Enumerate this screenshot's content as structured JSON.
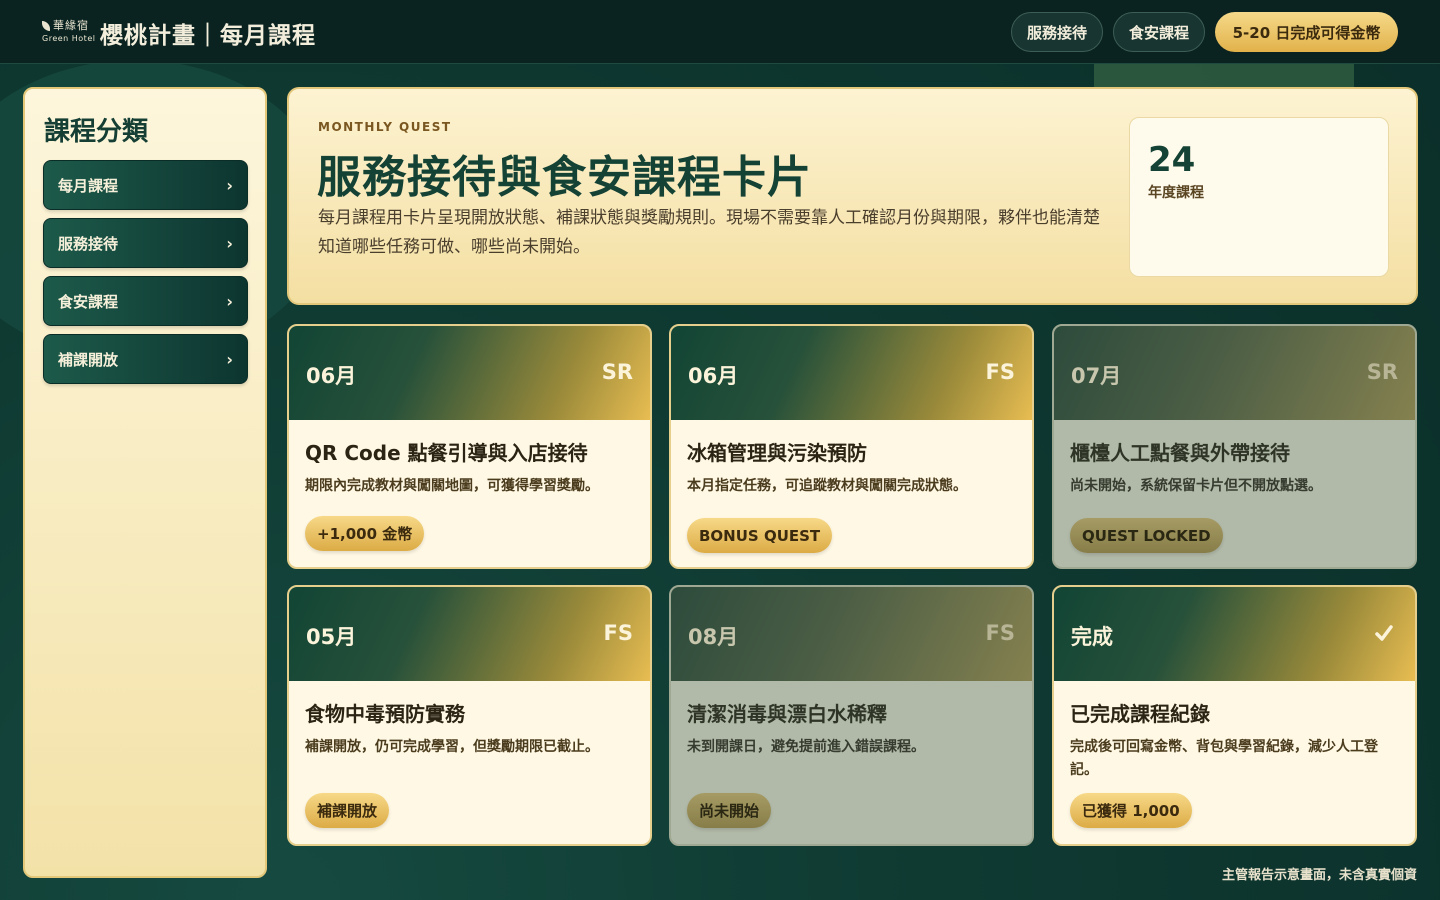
{
  "header": {
    "logo_cn": "華緣宿",
    "logo_en": "Green Hotel",
    "title": "櫻桃計畫｜每月課程",
    "nav": [
      "服務接待",
      "食安課程"
    ],
    "cta_label": "5-20 日完成可得金幣"
  },
  "sidebar": {
    "title": "課程分類",
    "items": [
      {
        "label": "每月課程"
      },
      {
        "label": "服務接待"
      },
      {
        "label": "食安課程"
      },
      {
        "label": "補課開放"
      }
    ]
  },
  "hero": {
    "kicker": "MONTHLY QUEST",
    "title": "服務接待與食安課程卡片",
    "description": "每月課程用卡片呈現開放狀態、補課狀態與獎勵規則。現場不需要靠人工確認月份與期限，夥伴也能清楚知道哪些任務可做、哪些尚未開始。",
    "stat_value": "24",
    "stat_label": "年度課程"
  },
  "cards": [
    {
      "month": "06月",
      "tag": "SR",
      "title": "QR Code 點餐引導與入店接待",
      "desc": "期限內完成教材與闖關地圖，可獲得學習獎勵。",
      "badge": "+1,000 金幣",
      "state": "open"
    },
    {
      "month": "06月",
      "tag": "FS",
      "title": "冰箱管理與污染預防",
      "desc": "本月指定任務，可追蹤教材與闖關完成狀態。",
      "badge": "BONUS QUEST",
      "state": "open"
    },
    {
      "month": "07月",
      "tag": "SR",
      "title": "櫃檯人工點餐與外帶接待",
      "desc": "尚未開始，系統保留卡片但不開放點選。",
      "badge": "QUEST LOCKED",
      "state": "locked"
    },
    {
      "month": "05月",
      "tag": "FS",
      "title": "食物中毒預防實務",
      "desc": "補課開放，仍可完成學習，但獎勵期限已截止。",
      "badge": "補課開放",
      "state": "makeup"
    },
    {
      "month": "08月",
      "tag": "FS",
      "title": "清潔消毒與漂白水稀釋",
      "desc": "未到開課日，避免提前進入錯誤課程。",
      "badge": "尚未開始",
      "state": "locked"
    },
    {
      "month": "完成",
      "tag": "",
      "title": "已完成課程紀錄",
      "desc": "完成後可回寫金幣、背包與學習紀錄，減少人工登記。",
      "badge": "已獲得 1,000",
      "state": "done"
    }
  ],
  "footer_note": "主管報告示意畫面，未含真實個資",
  "colors": {
    "primary_green": "#144235",
    "gold": "#e2b24a",
    "cream": "#fdf3d2"
  }
}
